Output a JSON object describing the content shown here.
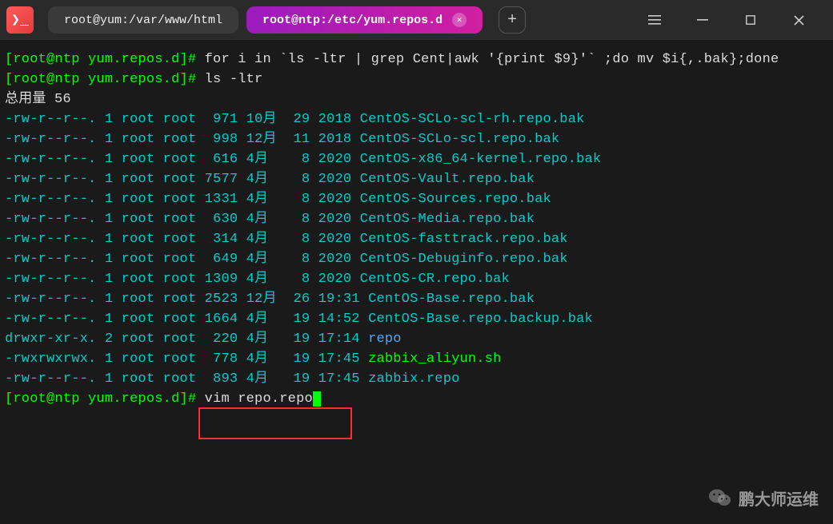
{
  "titlebar": {
    "tabs": [
      {
        "label": "root@yum:/var/www/html",
        "active": false
      },
      {
        "label": "root@ntp:/etc/yum.repos.d",
        "active": true
      }
    ]
  },
  "terminal": {
    "line1_prompt": "[root@ntp yum.repos.d]#",
    "line1_cmd": " for i in `ls -ltr | grep Cent|awk '{print $9}'` ;do mv $i{,.bak};done",
    "line2_prompt": "[root@ntp yum.repos.d]#",
    "line2_cmd": " ls -ltr",
    "total_line": "总用量 56",
    "files": [
      {
        "perm": "-rw-r--r--.",
        "links": "1",
        "owner": "root",
        "group": "root",
        "size": " 971",
        "month": "10月",
        "day": " 29",
        "time": "2018",
        "name": "CentOS-SCLo-scl-rh.repo.bak",
        "color": "teal"
      },
      {
        "perm": "-rw-r--r--.",
        "links": "1",
        "owner": "root",
        "group": "root",
        "size": " 998",
        "month": "12月",
        "day": " 11",
        "time": "2018",
        "name": "CentOS-SCLo-scl.repo.bak",
        "color": "teal"
      },
      {
        "perm": "-rw-r--r--.",
        "links": "1",
        "owner": "root",
        "group": "root",
        "size": " 616",
        "month": "4月 ",
        "day": "  8",
        "time": "2020",
        "name": "CentOS-x86_64-kernel.repo.bak",
        "color": "teal"
      },
      {
        "perm": "-rw-r--r--.",
        "links": "1",
        "owner": "root",
        "group": "root",
        "size": "7577",
        "month": "4月 ",
        "day": "  8",
        "time": "2020",
        "name": "CentOS-Vault.repo.bak",
        "color": "teal"
      },
      {
        "perm": "-rw-r--r--.",
        "links": "1",
        "owner": "root",
        "group": "root",
        "size": "1331",
        "month": "4月 ",
        "day": "  8",
        "time": "2020",
        "name": "CentOS-Sources.repo.bak",
        "color": "teal"
      },
      {
        "perm": "-rw-r--r--.",
        "links": "1",
        "owner": "root",
        "group": "root",
        "size": " 630",
        "month": "4月 ",
        "day": "  8",
        "time": "2020",
        "name": "CentOS-Media.repo.bak",
        "color": "teal"
      },
      {
        "perm": "-rw-r--r--.",
        "links": "1",
        "owner": "root",
        "group": "root",
        "size": " 314",
        "month": "4月 ",
        "day": "  8",
        "time": "2020",
        "name": "CentOS-fasttrack.repo.bak",
        "color": "teal"
      },
      {
        "perm": "-rw-r--r--.",
        "links": "1",
        "owner": "root",
        "group": "root",
        "size": " 649",
        "month": "4月 ",
        "day": "  8",
        "time": "2020",
        "name": "CentOS-Debuginfo.repo.bak",
        "color": "teal"
      },
      {
        "perm": "-rw-r--r--.",
        "links": "1",
        "owner": "root",
        "group": "root",
        "size": "1309",
        "month": "4月 ",
        "day": "  8",
        "time": "2020",
        "name": "CentOS-CR.repo.bak",
        "color": "teal"
      },
      {
        "perm": "-rw-r--r--.",
        "links": "1",
        "owner": "root",
        "group": "root",
        "size": "2523",
        "month": "12月",
        "day": " 26",
        "time": "19:31",
        "name": "CentOS-Base.repo.bak",
        "color": "teal"
      },
      {
        "perm": "-rw-r--r--.",
        "links": "1",
        "owner": "root",
        "group": "root",
        "size": "1664",
        "month": "4月 ",
        "day": " 19",
        "time": "14:52",
        "name": "CentOS-Base.repo.backup.bak",
        "color": "teal"
      },
      {
        "perm": "drwxr-xr-x.",
        "links": "2",
        "owner": "root",
        "group": "root",
        "size": " 220",
        "month": "4月 ",
        "day": " 19",
        "time": "17:14",
        "name": "repo",
        "color": "blue"
      },
      {
        "perm": "-rwxrwxrwx.",
        "links": "1",
        "owner": "root",
        "group": "root",
        "size": " 778",
        "month": "4月 ",
        "day": " 19",
        "time": "17:45",
        "name": "zabbix_aliyun.sh",
        "color": "prompt"
      },
      {
        "perm": "-rw-r--r--.",
        "links": "1",
        "owner": "root",
        "group": "root",
        "size": " 893",
        "month": "4月 ",
        "day": " 19",
        "time": "17:45",
        "name": "zabbix.repo",
        "color": "teal"
      }
    ],
    "line_last_prompt": "[root@ntp yum.repos.d]#",
    "line_last_cmd": " vim repo.repo"
  },
  "watermark": {
    "text": "鹏大师运维"
  }
}
